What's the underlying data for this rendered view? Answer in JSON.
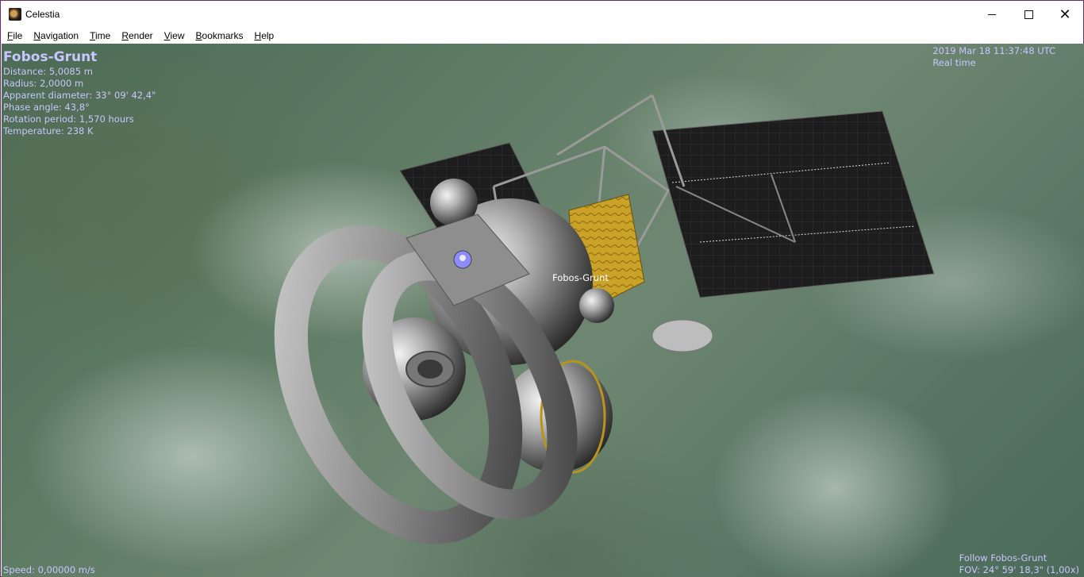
{
  "window": {
    "title": "Celestia",
    "app_icon": "celestia-app-icon"
  },
  "menu": {
    "items": [
      {
        "label_u": "F",
        "label_rest": "ile"
      },
      {
        "label_u": "N",
        "label_rest": "avigation"
      },
      {
        "label_u": "T",
        "label_rest": "ime"
      },
      {
        "label_u": "R",
        "label_rest": "ender"
      },
      {
        "label_u": "V",
        "label_rest": "iew"
      },
      {
        "label_u": "B",
        "label_rest": "ookmarks"
      },
      {
        "label_u": "H",
        "label_rest": "elp"
      }
    ]
  },
  "info": {
    "name": "Fobos-Grunt",
    "distance": "Distance: 5,0085 m",
    "radius": "Radius: 2,0000 m",
    "apparent_diameter": "Apparent diameter: 33° 09' 42,4\"",
    "phase_angle": "Phase angle: 43,8°",
    "rotation_period": "Rotation period: 1,570 hours",
    "temperature": "Temperature: 238 K"
  },
  "time": {
    "datetime": "2019 Mar 18 11:37:48 UTC",
    "mode": "Real time"
  },
  "status": {
    "speed": "Speed: 0,00000 m/s",
    "follow": "Follow Fobos-Grunt",
    "fov": "FOV: 24° 59' 18,3\" (1,00x)"
  },
  "scene": {
    "object_label": "Fobos-Grunt",
    "colors": {
      "hud_text": "#c8c6ff",
      "hull": "#9a9a9a",
      "solar_panel": "#1c1c1c",
      "foil": "#c9a227"
    }
  }
}
